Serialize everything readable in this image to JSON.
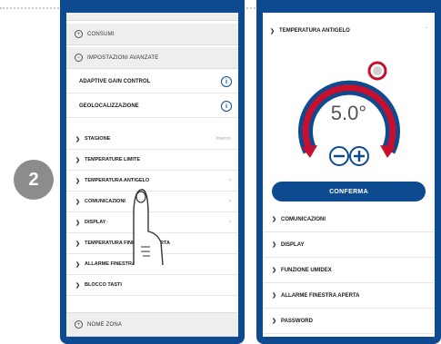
{
  "step_number": "2",
  "left_phone": {
    "consumi": "CONSUMI",
    "advanced_settings": "IMPOSTAZIONI AVANZATE",
    "adaptive_gain": "ADAPTIVE GAIN CONTROL",
    "geolocalizzazione": "GEOLOCALIZZAZIONE",
    "menu": [
      {
        "label": "STAGIONE",
        "right": "Inverno"
      },
      {
        "label": "TEMPERATURE LIMITE",
        "right": ""
      },
      {
        "label": "TEMPERATURA ANTIGELO",
        "right": "›"
      },
      {
        "label": "COMUNICAZIONI",
        "right": "›"
      },
      {
        "label": "DISPLAY",
        "right": "›"
      },
      {
        "label": "TEMPERATURA FINESTRA APERTA",
        "right": ""
      },
      {
        "label": "ALLARME FINESTRA APERTA",
        "right": ""
      },
      {
        "label": "BLOCCO TASTI",
        "right": ""
      }
    ],
    "zone_name": "NOME ZONA"
  },
  "right_phone": {
    "header": "TEMPERATURA ANTIGELO",
    "temperature": "5.0°",
    "confirm": "CONFERMA",
    "menu": [
      "COMUNICAZIONI",
      "DISPLAY",
      "FUNZIONE UMIDEX",
      "ALLARME FINESTRA APERTA",
      "PASSWORD"
    ]
  },
  "colors": {
    "brand_blue": "#0d4a8f",
    "dial_red": "#c8102e",
    "badge_gray": "#8c8c8c"
  }
}
